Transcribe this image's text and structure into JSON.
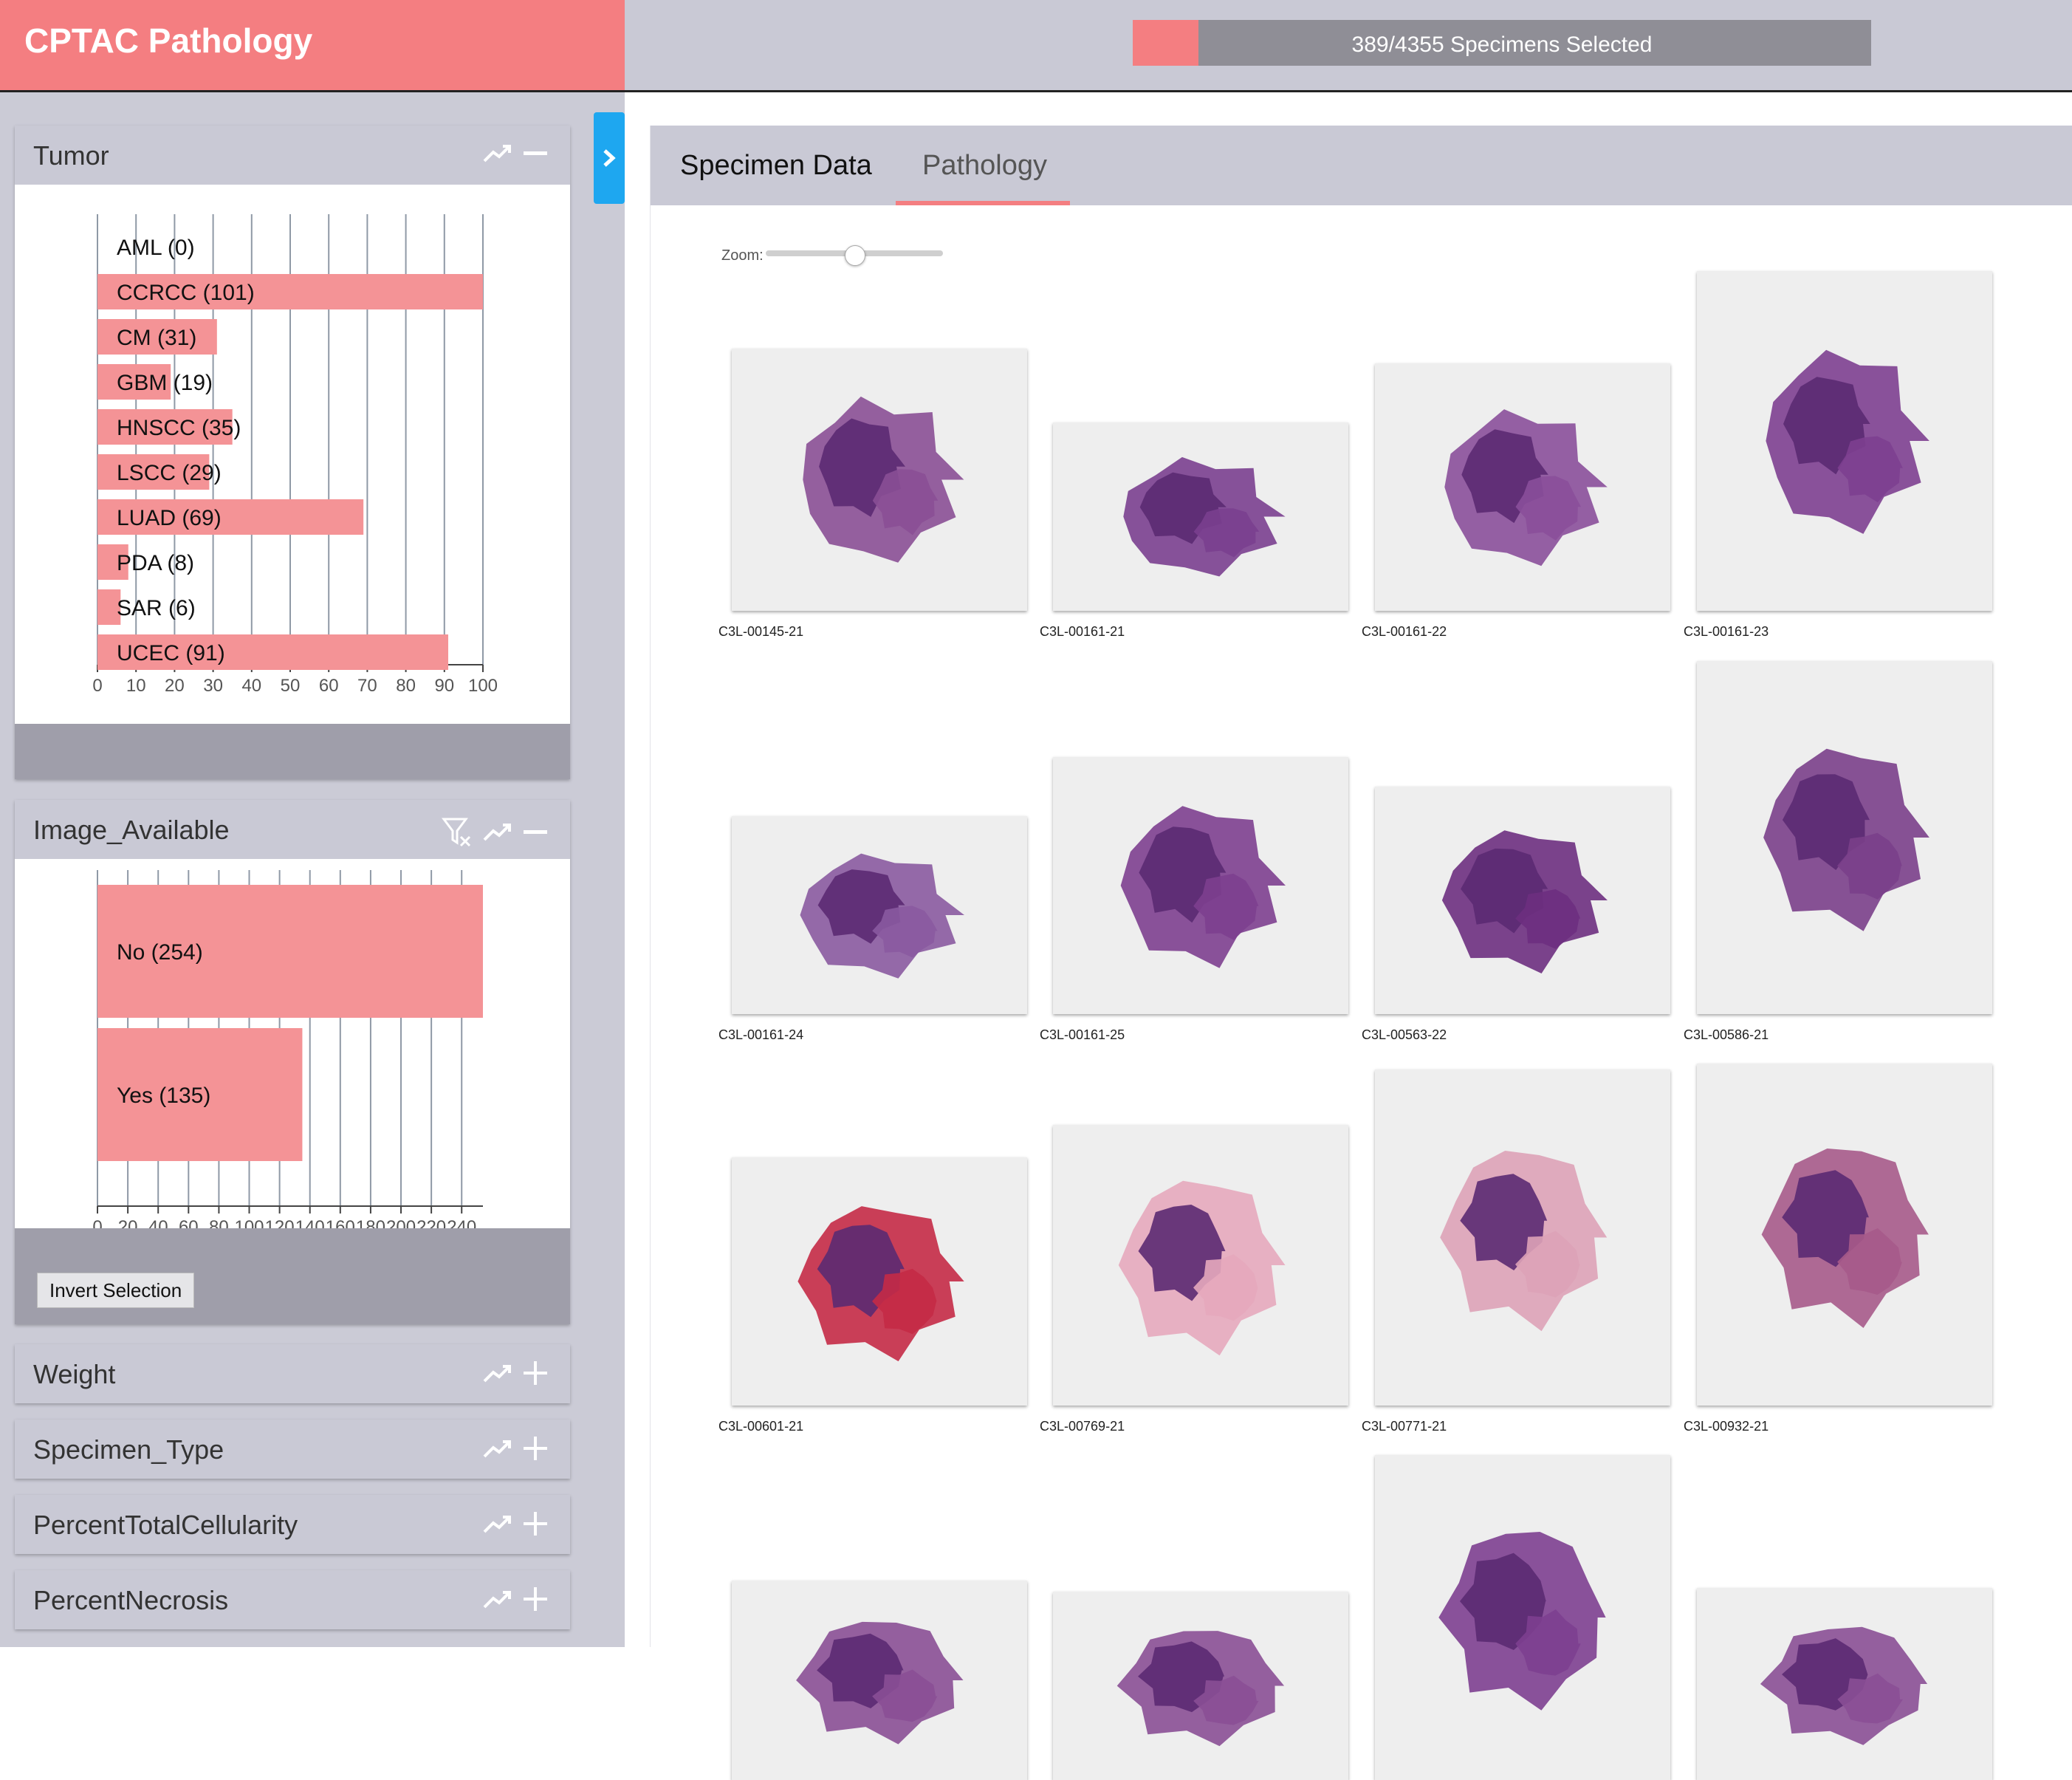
{
  "app": {
    "title": "CPTAC Pathology",
    "selection": {
      "selected": 389,
      "total": 4355,
      "text": "389/4355 Specimens Selected"
    }
  },
  "colors": {
    "brand": "#f47e81",
    "bar": "#f49396",
    "accent_blue": "#1ea7f0"
  },
  "sidebar": {
    "panels": [
      {
        "title": "Tumor",
        "chart_data": {
          "type": "bar",
          "orientation": "horizontal",
          "categories": [
            "AML (0)",
            "CCRCC (101)",
            "CM (31)",
            "GBM (19)",
            "HNSCC (35)",
            "LSCC (29)",
            "LUAD (69)",
            "PDA (8)",
            "SAR (6)",
            "UCEC (91)"
          ],
          "values": [
            0,
            101,
            31,
            19,
            35,
            29,
            69,
            8,
            6,
            91
          ],
          "xlim": [
            0,
            100
          ],
          "ticks": [
            0,
            10,
            20,
            30,
            40,
            50,
            60,
            70,
            80,
            90,
            100
          ],
          "grid": true
        }
      },
      {
        "title": "Image_Available",
        "chart_data": {
          "type": "bar",
          "orientation": "horizontal",
          "categories": [
            "No (254)",
            "Yes (135)"
          ],
          "values": [
            254,
            135
          ],
          "xlim": [
            0,
            254
          ],
          "ticks": [
            0,
            20,
            40,
            60,
            80,
            100,
            120,
            140,
            160,
            180,
            200,
            220,
            240
          ],
          "grid": true
        },
        "invert_label": "Invert Selection"
      }
    ],
    "collapsed": [
      "Weight",
      "Specimen_Type",
      "PercentTotalCellularity",
      "PercentNecrosis"
    ]
  },
  "main": {
    "tabs": [
      "Specimen Data",
      "Pathology"
    ],
    "active_tab": "Pathology",
    "zoom": {
      "label": "Zoom:",
      "value": 0.5
    },
    "thumbnails": [
      {
        "id": "C3L-00145-21",
        "tone": "#8a4f95"
      },
      {
        "id": "C3L-00161-21",
        "tone": "#7a3f8f"
      },
      {
        "id": "C3L-00161-22",
        "tone": "#8a4f9a"
      },
      {
        "id": "C3L-00161-23",
        "tone": "#7d3f90"
      },
      {
        "id": "C3L-00161-24",
        "tone": "#8a5aa0"
      },
      {
        "id": "C3L-00161-25",
        "tone": "#7d3f8f"
      },
      {
        "id": "C3L-00563-22",
        "tone": "#6d2f80"
      },
      {
        "id": "C3L-00586-21",
        "tone": "#7a3f8a"
      },
      {
        "id": "C3L-00601-21",
        "tone": "#c42a46"
      },
      {
        "id": "C3L-00769-21",
        "tone": "#e6a9bc"
      },
      {
        "id": "C3L-00771-21",
        "tone": "#dda2b7"
      },
      {
        "id": "C3L-00932-21",
        "tone": "#a65a8a"
      },
      {
        "id": "",
        "tone": "#8a4f95"
      },
      {
        "id": "",
        "tone": "#8a4f95"
      },
      {
        "id": "",
        "tone": "#7d3f90"
      },
      {
        "id": "",
        "tone": "#8a4f95"
      }
    ]
  }
}
